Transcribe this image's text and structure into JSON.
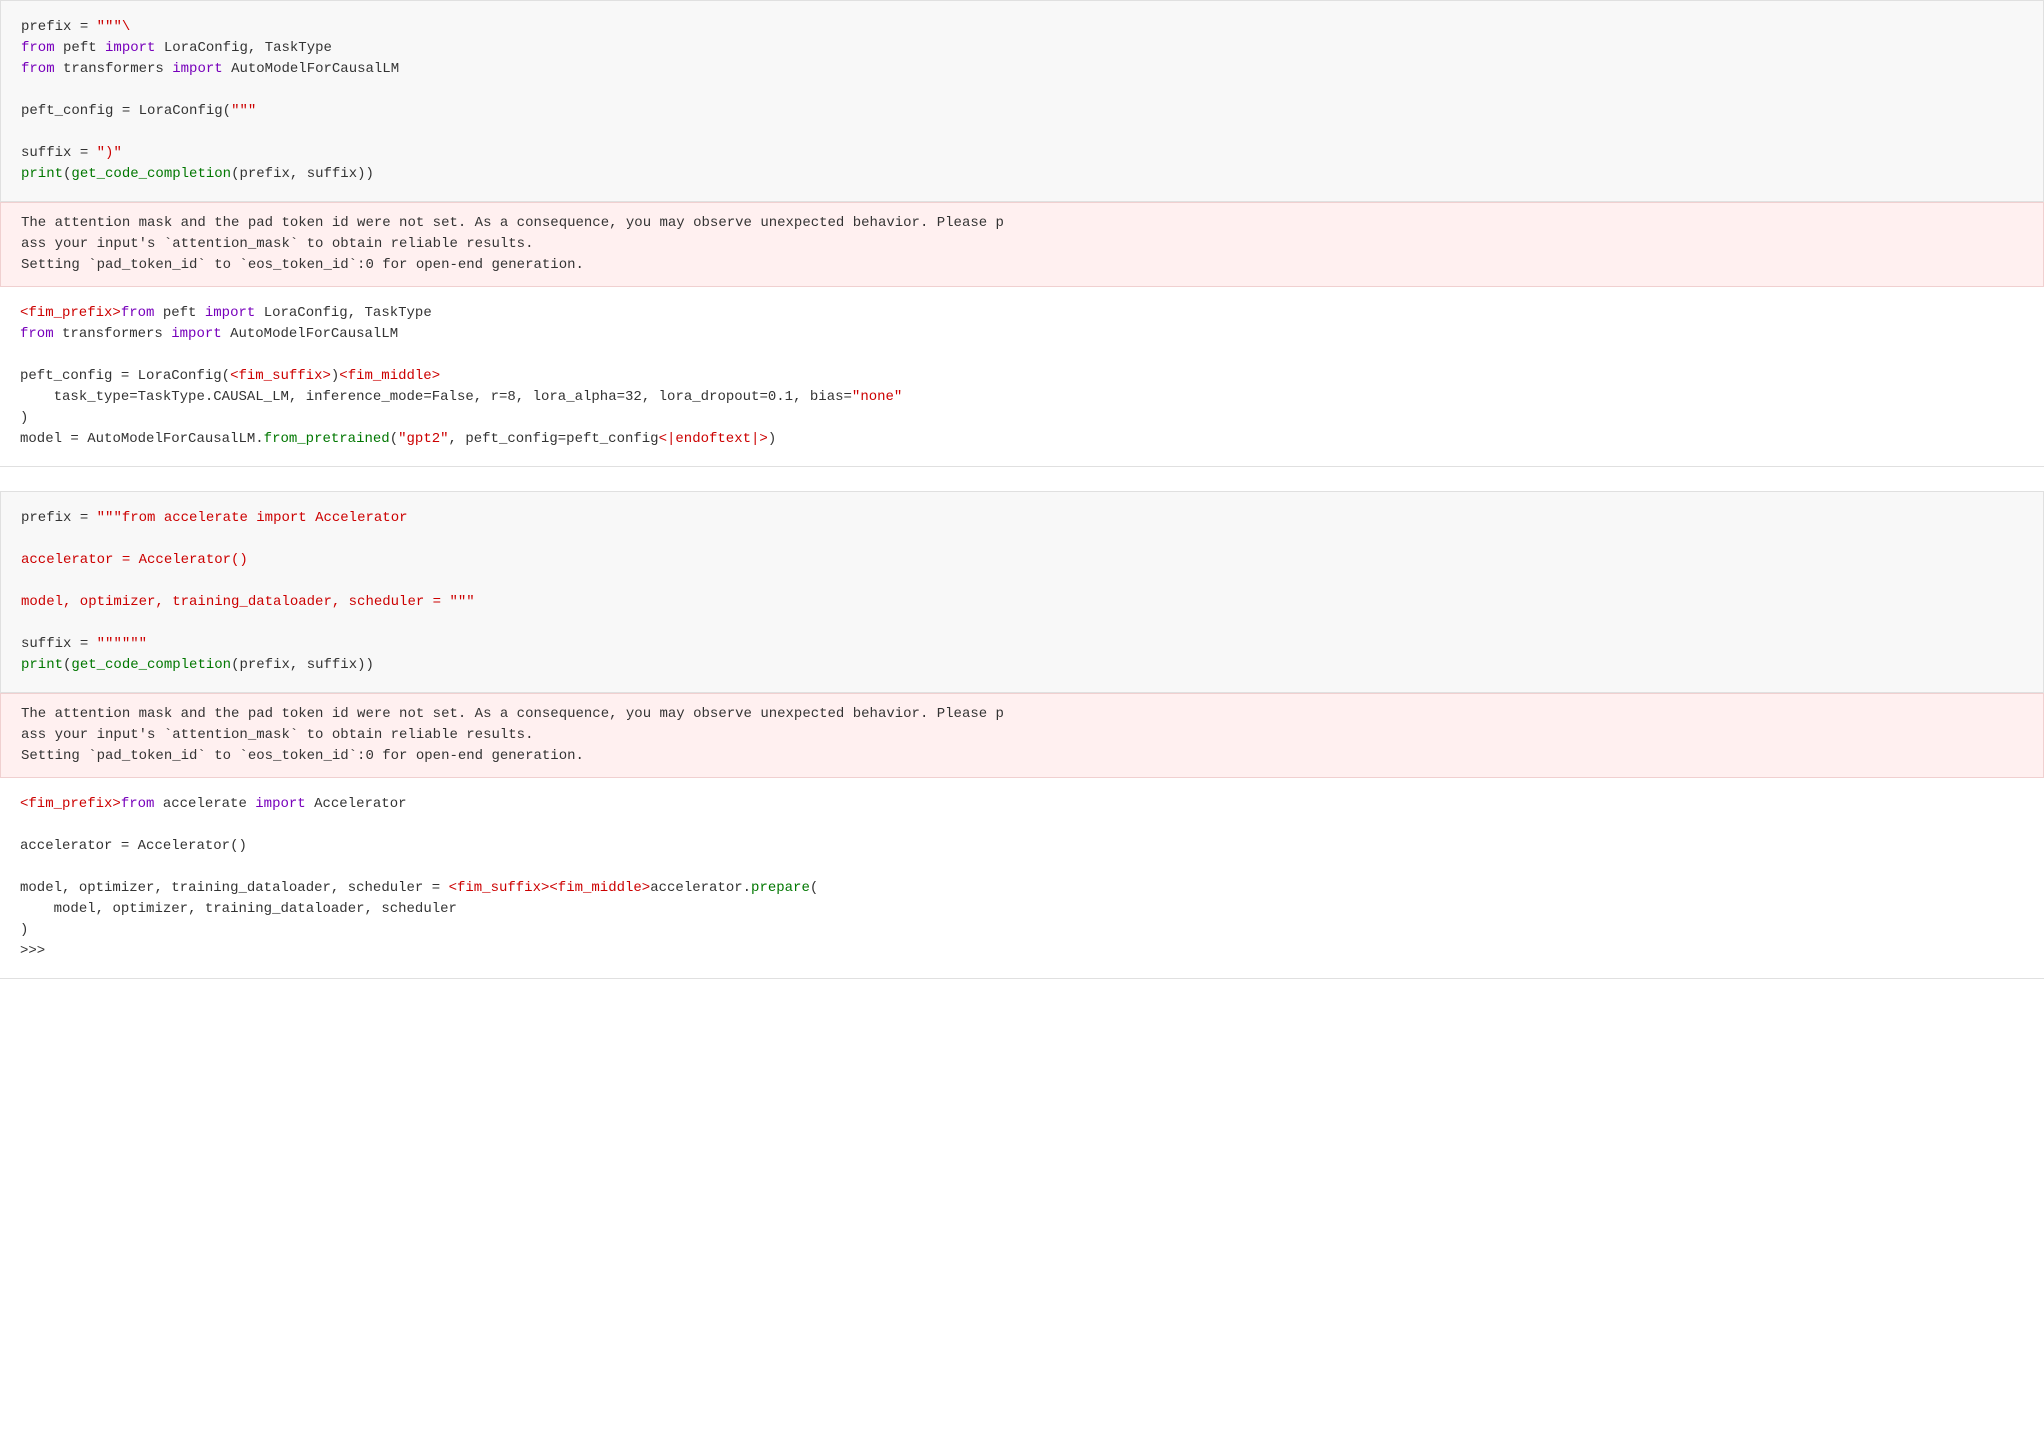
{
  "blocks": [
    {
      "type": "code",
      "id": "code-block-1"
    },
    {
      "type": "warning",
      "id": "warning-block-1",
      "text": "The attention mask and the pad token id were not set. As a consequence, you may observe unexpected behavior. Please p\nass your input's `attention_mask` to obtain reliable results.\nSetting `pad_token_id` to `eos_token_id`:0 for open-end generation."
    },
    {
      "type": "output",
      "id": "output-block-1"
    },
    {
      "type": "gap"
    },
    {
      "type": "code",
      "id": "code-block-2"
    },
    {
      "type": "warning",
      "id": "warning-block-2",
      "text": "The attention mask and the pad token id were not set. As a consequence, you may observe unexpected behavior. Please p\nass your input's `attention_mask` to obtain reliable results.\nSetting `pad_token_id` to `eos_token_id`:0 for open-end generation."
    },
    {
      "type": "output",
      "id": "output-block-2"
    }
  ]
}
